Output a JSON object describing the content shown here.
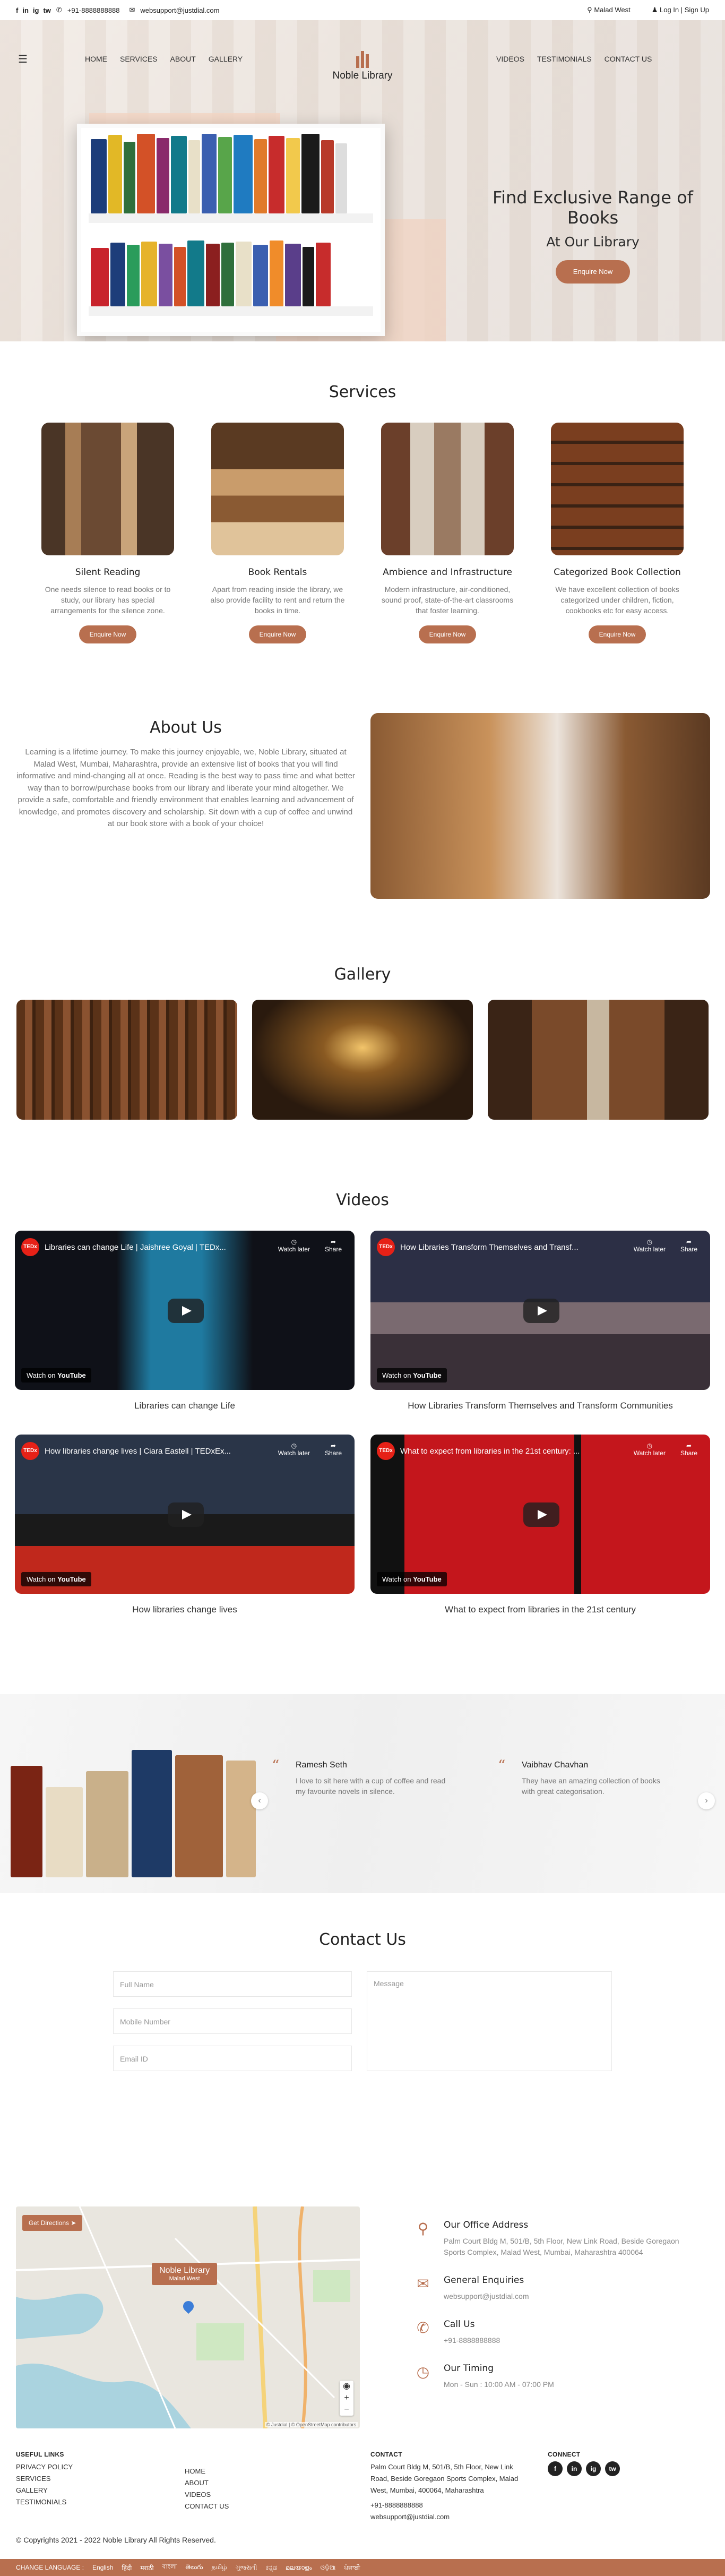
{
  "topbar": {
    "phone": "+91-8888888888",
    "email": "websupport@justdial.com",
    "location": "Malad West",
    "auth": "Log In | Sign Up",
    "social": [
      "f",
      "in",
      "ig",
      "tw"
    ]
  },
  "nav": {
    "left": [
      "HOME",
      "SERVICES",
      "ABOUT",
      "GALLERY"
    ],
    "right": [
      "VIDEOS",
      "TESTIMONIALS",
      "CONTACT US"
    ],
    "brand": "Noble Library"
  },
  "hero": {
    "title": "Find Exclusive Range of Books",
    "subtitle": "At Our Library",
    "cta": "Enquire Now"
  },
  "services": {
    "title": "Services",
    "items": [
      {
        "title": "Silent Reading",
        "desc": "One needs silence to read books or to study, our library has special arrangements for the silence zone.",
        "cta": "Enquire Now"
      },
      {
        "title": "Book Rentals",
        "desc": "Apart from reading inside the library, we also provide facility to rent and return the books in time.",
        "cta": "Enquire Now"
      },
      {
        "title": "Ambience and Infrastructure",
        "desc": "Modern infrastructure, air-conditioned, sound proof, state-of-the-art classrooms that foster learning.",
        "cta": "Enquire Now"
      },
      {
        "title": "Categorized Book Collection",
        "desc": "We have excellent collection of books categorized under children, fiction, cookbooks etc for easy access.",
        "cta": "Enquire Now"
      }
    ]
  },
  "about": {
    "title": "About Us",
    "body": "Learning is a lifetime journey. To make this journey enjoyable, we, Noble Library, situated at Malad West, Mumbai, Maharashtra, provide an extensive list of books that you will find informative and mind-changing all at once. Reading is the best way to pass time and what better way than to borrow/purchase books from our library and liberate your mind altogether. We provide a safe, comfortable and friendly environment that enables learning and advancement of knowledge, and promotes discovery and scholarship. Sit down with a cup of coffee and unwind at our book store with a book of your choice!"
  },
  "gallery": {
    "title": "Gallery"
  },
  "videos": {
    "title": "Videos",
    "watch_later": "Watch later",
    "share": "Share",
    "watch_on": "Watch on",
    "youtube": "YouTube",
    "items": [
      {
        "embed_title": "Libraries can change Life | Jaishree Goyal | TEDx...",
        "caption": "Libraries can change Life"
      },
      {
        "embed_title": "How Libraries Transform Themselves and Transf...",
        "caption": "How Libraries Transform Themselves and Transform Communities"
      },
      {
        "embed_title": "How libraries change lives | Ciara Eastell | TEDxEx...",
        "caption": "How libraries change lives"
      },
      {
        "embed_title": "What to expect from libraries in the 21st century: ...",
        "caption": "What to expect from libraries in the 21st century"
      }
    ]
  },
  "testimonials": {
    "items": [
      {
        "name": "Ramesh Seth",
        "text": "I love to sit here with a cup of coffee and read my favourite novels in silence."
      },
      {
        "name": "Vaibhav Chavhan",
        "text": "They have an amazing collection of books with great categorisation."
      }
    ]
  },
  "contact": {
    "title": "Contact Us",
    "full_name": "Full Name",
    "mobile": "Mobile Number",
    "email": "Email ID",
    "message": "Message"
  },
  "map": {
    "directions": "Get Directions",
    "pin_title": "Noble Library",
    "pin_sub": "Malad West",
    "attribution": "© Justdial  |  © OpenStreetMap contributors"
  },
  "info": {
    "office_title": "Our Office Address",
    "office_text": "Palm Court Bldg M, 501/B, 5th Floor, New Link Road, Beside Goregaon Sports Complex, Malad West, Mumbai, Maharashtra 400064",
    "enq_title": "General Enquiries",
    "enq_text": "websupport@justdial.com",
    "call_title": "Call Us",
    "call_text": "+91-8888888888",
    "time_title": "Our Timing",
    "time_text": "Mon - Sun : 10:00 AM - 07:00 PM"
  },
  "footer": {
    "useful_title": "USEFUL LINKS",
    "useful_a": [
      "PRIVACY POLICY",
      "SERVICES",
      "GALLERY",
      "TESTIMONIALS"
    ],
    "useful_b": [
      "HOME",
      "ABOUT",
      "VIDEOS",
      "CONTACT US"
    ],
    "contact_title": "CONTACT",
    "contact_addr": "Palm Court Bldg M, 501/B, 5th Floor, New Link Road, Beside Goregaon Sports Complex, Malad West, Mumbai, 400064, Maharashtra",
    "contact_phone": "+91-8888888888",
    "contact_email": "websupport@justdial.com",
    "connect_title": "CONNECT",
    "copyright": "© Copyrights 2021 - 2022 Noble Library All Rights Reserved."
  },
  "lang": {
    "label": "CHANGE LANGUAGE :",
    "items": [
      "English",
      "हिंदी",
      "मराठी",
      "বাংলা",
      "తెలుగు",
      "தமிழ்",
      "ગુજરાતી",
      "ಕನ್ನಡ",
      "മലയാളം",
      "ଓଡ଼ିଆ",
      "ਪੰਜਾਬੀ"
    ]
  },
  "colors": {
    "accent": "#b86f4f"
  }
}
